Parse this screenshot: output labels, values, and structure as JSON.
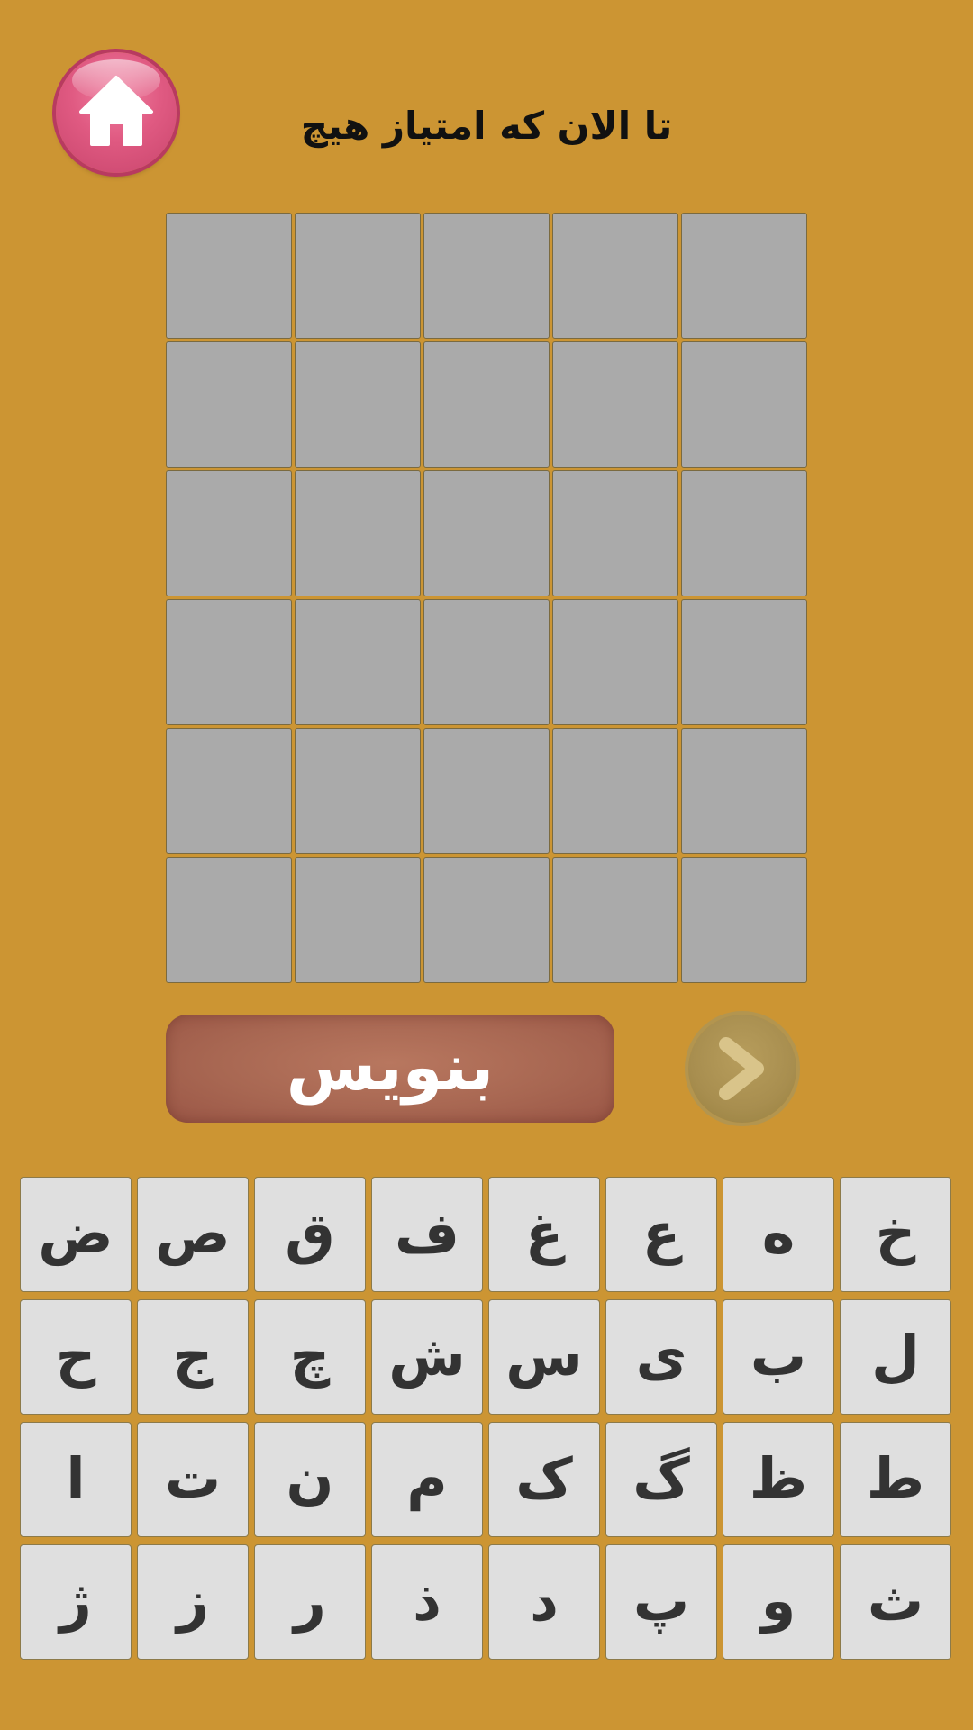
{
  "header": {
    "home_icon": "home-icon",
    "score_text": "تا الان که امتیاز هیچ"
  },
  "board": {
    "rows": 6,
    "columns": 5,
    "cells": [
      [
        "",
        "",
        "",
        "",
        ""
      ],
      [
        "",
        "",
        "",
        "",
        ""
      ],
      [
        "",
        "",
        "",
        "",
        ""
      ],
      [
        "",
        "",
        "",
        "",
        ""
      ],
      [
        "",
        "",
        "",
        "",
        ""
      ],
      [
        "",
        "",
        "",
        "",
        ""
      ]
    ]
  },
  "actions": {
    "submit_label": "بنویس",
    "next_icon": "chevron-right-icon"
  },
  "keyboard": {
    "rows": [
      [
        "خ",
        "ه",
        "ع",
        "غ",
        "ف",
        "ق",
        "ص",
        "ض"
      ],
      [
        "ل",
        "ب",
        "ی",
        "س",
        "ش",
        "چ",
        "ج",
        "ح"
      ],
      [
        "ط",
        "ظ",
        "گ",
        "ک",
        "م",
        "ن",
        "ت",
        "ا"
      ],
      [
        "ث",
        "و",
        "پ",
        "د",
        "ذ",
        "ر",
        "ز",
        "ژ"
      ]
    ]
  },
  "colors": {
    "background": "#CC9533",
    "cell": "#AAAAAA",
    "submit": "#A86752",
    "key": "#DFDFDF",
    "home": "#E05A82"
  }
}
